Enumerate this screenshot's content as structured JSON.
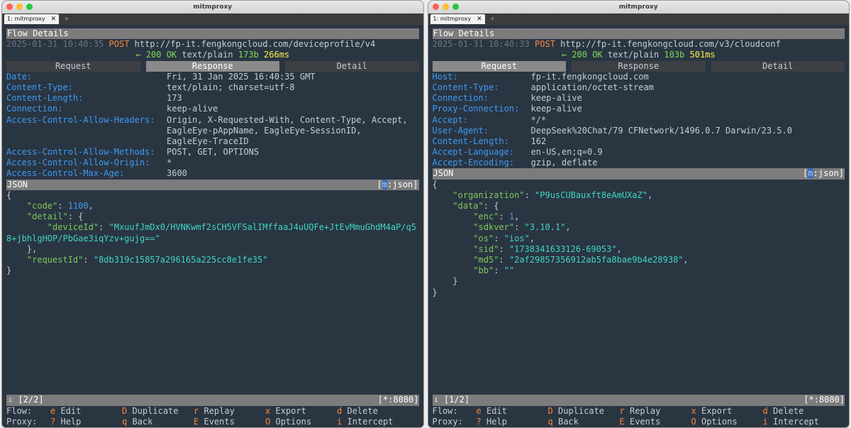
{
  "left": {
    "window_title": "mitmproxy",
    "tab_label": "1: mitmproxy",
    "tab_close": "✕",
    "tab_add": "+",
    "flow_title": "Flow Details",
    "timestamp": "2025-01-31 10:40:35",
    "method": "POST",
    "url": "http://fp-it.fengkongcloud.com/deviceprofile/v4",
    "arrow": "←",
    "status": "200 OK",
    "content_type": "text/plain",
    "size": "173b",
    "duration": "266ms",
    "tabs": [
      "Request",
      "Response",
      "Detail"
    ],
    "active_tab": 1,
    "headers": [
      {
        "k": "Date:",
        "v": [
          "Fri, 31 Jan 2025 16:40:35 GMT"
        ]
      },
      {
        "k": "Content-Type:",
        "v": [
          "text/plain; charset=utf-8"
        ]
      },
      {
        "k": "Content-Length:",
        "v": [
          "173"
        ]
      },
      {
        "k": "Connection:",
        "v": [
          "keep-alive"
        ]
      },
      {
        "k": "Access-Control-Allow-Headers:",
        "v": [
          "Origin, X-Requested-With, Content-Type, Accept,",
          "EagleEye-pAppName, EagleEye-SessionID,",
          "EagleEye-TraceID"
        ]
      },
      {
        "k": "Access-Control-Allow-Methods:",
        "v": [
          "POST, GET, OPTIONS"
        ]
      },
      {
        "k": "Access-Control-Allow-Origin:",
        "v": [
          "*"
        ]
      },
      {
        "k": "Access-Control-Max-Age:",
        "v": [
          "3600"
        ]
      }
    ],
    "json_title": "JSON",
    "json_mode": ":json]",
    "json_mode_prefix": "[",
    "json_mode_key": "m",
    "json_lines": [
      [
        [
          "p",
          "{"
        ]
      ],
      [
        [
          "p",
          "    "
        ],
        [
          "k",
          "\"code\""
        ],
        [
          "p",
          ": "
        ],
        [
          "n",
          "1100"
        ],
        [
          "p",
          ","
        ]
      ],
      [
        [
          "p",
          "    "
        ],
        [
          "k",
          "\"detail\""
        ],
        [
          "p",
          ": {"
        ]
      ],
      [
        [
          "p",
          "        "
        ],
        [
          "k",
          "\"deviceId\""
        ],
        [
          "p",
          ": "
        ],
        [
          "s",
          "\"MxuufJmDx0/HVNKwmf2sCH5VFSalIMffaaJ4uUQFe+JtEvMmuGhdM4aP/q5"
        ]
      ],
      [
        [
          "s",
          "8+jbhlgHOP/PbGae3iqYzv+gujg==\""
        ]
      ],
      [
        [
          "p",
          "    },"
        ]
      ],
      [
        [
          "p",
          "    "
        ],
        [
          "k",
          "\"requestId\""
        ],
        [
          "p",
          ": "
        ],
        [
          "s",
          "\"8db319c15857a296165a225cc8e1fe35\""
        ]
      ],
      [
        [
          "p",
          "}"
        ]
      ]
    ],
    "status_left": "⇩  [2/2]",
    "status_right": "[*:8080]"
  },
  "right": {
    "window_title": "mitmproxy",
    "tab_label": "1: mitmproxy",
    "tab_close": "✕",
    "tab_add": "+",
    "flow_title": "Flow Details",
    "timestamp": "2025-01-31 10:40:33",
    "method": "POST",
    "url": "http://fp-it.fengkongcloud.com/v3/cloudconf",
    "arrow": "←",
    "status": "200 OK",
    "content_type": "text/plain",
    "size": "103b",
    "duration": "501ms",
    "tabs": [
      "Request",
      "Response",
      "Detail"
    ],
    "active_tab": 0,
    "headers": [
      {
        "k": "Host:",
        "v": [
          "fp-it.fengkongcloud.com"
        ]
      },
      {
        "k": "Content-Type:",
        "v": [
          "application/octet-stream"
        ]
      },
      {
        "k": "Connection:",
        "v": [
          "keep-alive"
        ]
      },
      {
        "k": "Proxy-Connection:",
        "v": [
          "keep-alive"
        ]
      },
      {
        "k": "Accept:",
        "v": [
          "*/*"
        ]
      },
      {
        "k": "User-Agent:",
        "v": [
          "DeepSeek%20Chat/79 CFNetwork/1496.0.7 Darwin/23.5.0"
        ]
      },
      {
        "k": "Content-Length:",
        "v": [
          "162"
        ]
      },
      {
        "k": "Accept-Language:",
        "v": [
          "en-US,en;q=0.9"
        ]
      },
      {
        "k": "Accept-Encoding:",
        "v": [
          "gzip, deflate"
        ]
      }
    ],
    "json_title": "JSON",
    "json_mode": ":json]",
    "json_mode_prefix": "[",
    "json_mode_key": "m",
    "json_lines": [
      [
        [
          "p",
          "{"
        ]
      ],
      [
        [
          "p",
          "    "
        ],
        [
          "k",
          "\"organization\""
        ],
        [
          "p",
          ": "
        ],
        [
          "s",
          "\"P9usCUBauxft8eAmUXaZ\""
        ],
        [
          "p",
          ","
        ]
      ],
      [
        [
          "p",
          "    "
        ],
        [
          "k",
          "\"data\""
        ],
        [
          "p",
          ": {"
        ]
      ],
      [
        [
          "p",
          "        "
        ],
        [
          "k",
          "\"enc\""
        ],
        [
          "p",
          ": "
        ],
        [
          "n",
          "1"
        ],
        [
          "p",
          ","
        ]
      ],
      [
        [
          "p",
          "        "
        ],
        [
          "k",
          "\"sdkver\""
        ],
        [
          "p",
          ": "
        ],
        [
          "s",
          "\"3.10.1\""
        ],
        [
          "p",
          ","
        ]
      ],
      [
        [
          "p",
          "        "
        ],
        [
          "k",
          "\"os\""
        ],
        [
          "p",
          ": "
        ],
        [
          "s",
          "\"ios\""
        ],
        [
          "p",
          ","
        ]
      ],
      [
        [
          "p",
          "        "
        ],
        [
          "k",
          "\"sid\""
        ],
        [
          "p",
          ": "
        ],
        [
          "s",
          "\"1738341633126-69053\""
        ],
        [
          "p",
          ","
        ]
      ],
      [
        [
          "p",
          "        "
        ],
        [
          "k",
          "\"md5\""
        ],
        [
          "p",
          ": "
        ],
        [
          "s",
          "\"2af29857356912ab5fa8bae9b4e28938\""
        ],
        [
          "p",
          ","
        ]
      ],
      [
        [
          "p",
          "        "
        ],
        [
          "k",
          "\"bb\""
        ],
        [
          "p",
          ": "
        ],
        [
          "s",
          "\"\""
        ]
      ],
      [
        [
          "p",
          "    }"
        ]
      ],
      [
        [
          "p",
          "}"
        ]
      ]
    ],
    "status_left": "⇩  [1/2]",
    "status_right": "[*:8080]"
  },
  "keybar": {
    "flow_label": "Flow:",
    "proxy_label": "Proxy:",
    "flow_keys": [
      {
        "key": "e",
        "desc": "Edit"
      },
      {
        "key": "D",
        "desc": "Duplicate"
      },
      {
        "key": "r",
        "desc": "Replay"
      },
      {
        "key": "x",
        "desc": "Export"
      },
      {
        "key": "d",
        "desc": "Delete"
      }
    ],
    "proxy_keys": [
      {
        "key": "?",
        "desc": "Help"
      },
      {
        "key": "q",
        "desc": "Back"
      },
      {
        "key": "E",
        "desc": "Events"
      },
      {
        "key": "O",
        "desc": "Options"
      },
      {
        "key": "i",
        "desc": "Intercept"
      }
    ]
  }
}
